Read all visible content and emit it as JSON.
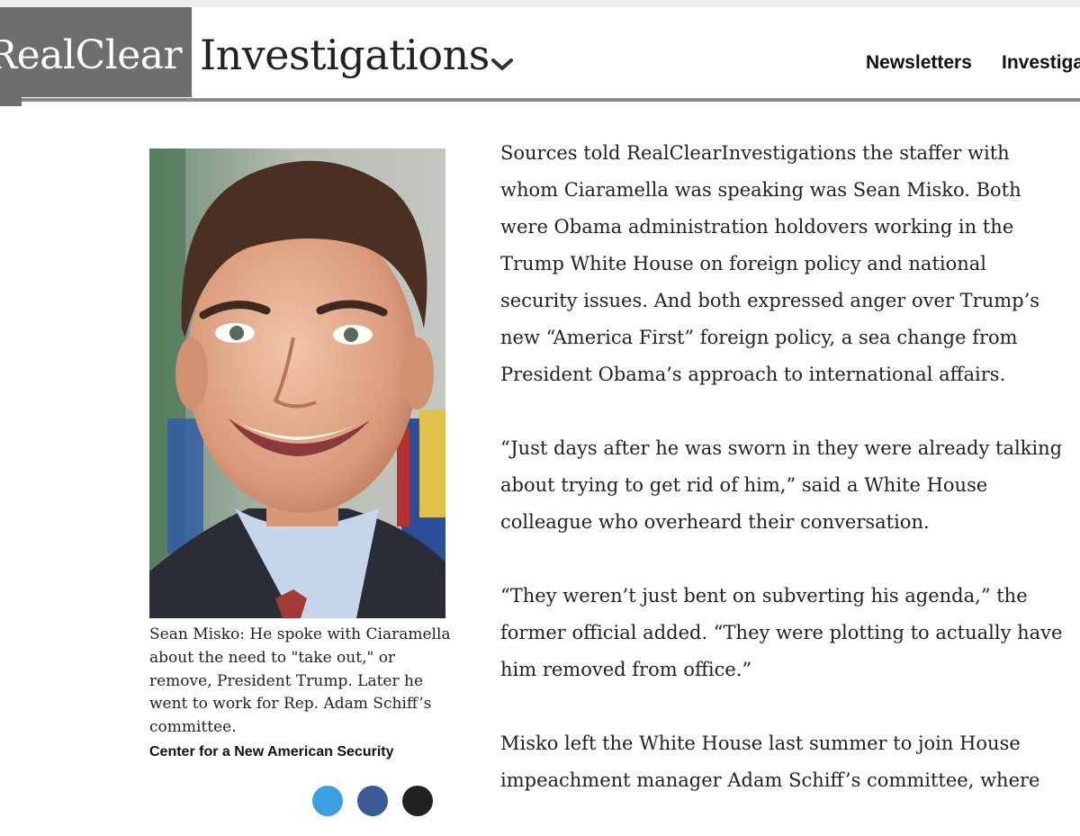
{
  "header": {
    "logo_prefix": "RealClear",
    "logo_section": "Investigations",
    "nav": [
      {
        "label": "Newsletters"
      },
      {
        "label": "Investiga"
      }
    ]
  },
  "photo": {
    "caption": "Sean Misko: He spoke with Ciaramella about the need to \"take out,\" or remove, President Trump. Later he went to work for Rep. Adam Schiff’s committee.",
    "credit": "Center for a New American Security"
  },
  "article": {
    "paragraphs": [
      "Sources told RealClearInvestigations the staffer with whom Ciaramella was speaking was Sean Misko. Both were Obama administration holdovers working in the Trump White House on foreign policy and national security issues. And both expressed anger over Trump’s new “America First” foreign policy, a sea change from President Obama’s approach to international affairs.",
      "“Just days after he was sworn in they were already talking about trying to get rid of him,” said a White House colleague who overheard their conversation.",
      "“They weren’t just bent on subverting his agenda,” the former official added. “They were plotting to actually have him removed from office.”",
      "Misko left the White House last summer to join House impeachment manager Adam Schiff’s committee, where"
    ]
  },
  "colors": {
    "logo_box": "#6e6e6e",
    "header_rule": "#8a8a8a",
    "text": "#222222"
  }
}
